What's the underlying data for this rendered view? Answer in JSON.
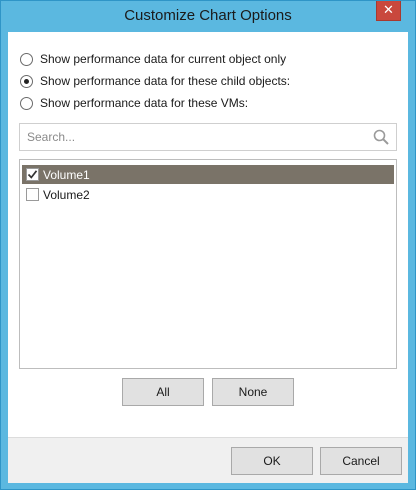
{
  "window": {
    "title": "Customize Chart Options",
    "close_label": "✕"
  },
  "options": {
    "selected_index": 1,
    "items": [
      {
        "label": "Show performance data for current object only"
      },
      {
        "label": "Show performance data for these child objects:"
      },
      {
        "label": "Show performance data for these VMs:"
      }
    ]
  },
  "search": {
    "placeholder": "Search...",
    "value": ""
  },
  "list": {
    "items": [
      {
        "label": "Volume1",
        "checked": true,
        "selected": true
      },
      {
        "label": "Volume2",
        "checked": false,
        "selected": false
      }
    ]
  },
  "selection_buttons": {
    "all_label": "All",
    "none_label": "None"
  },
  "footer": {
    "ok_label": "OK",
    "cancel_label": "Cancel"
  },
  "colors": {
    "titlebar": "#5bb8e0",
    "close_button": "#c9483d",
    "selected_row": "#7a7368"
  }
}
